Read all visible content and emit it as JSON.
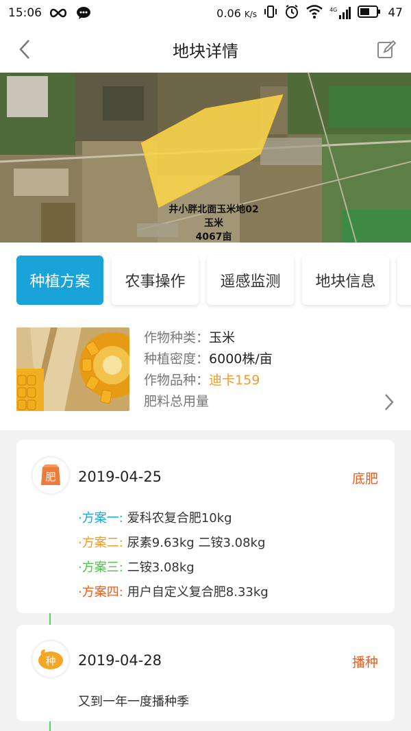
{
  "status_bar": {
    "time": "15:06",
    "speed": "0.06",
    "speed_unit": "K/s",
    "network": "4G",
    "battery": "47"
  },
  "header": {
    "title": "地块详情"
  },
  "map": {
    "plot_name": "井小胖北面玉米地02",
    "crop": "玉米",
    "area": "4067亩"
  },
  "tabs": [
    {
      "label": "种植方案",
      "active": true
    },
    {
      "label": "农事操作",
      "active": false
    },
    {
      "label": "遥感监测",
      "active": false
    },
    {
      "label": "地块信息",
      "active": false
    }
  ],
  "crop_info": {
    "type_label": "作物种类：",
    "type_value": "玉米",
    "density_label": "种植密度：",
    "density_value": "6000株/亩",
    "variety_label": "作物品种：",
    "variety_value": "迪卡159",
    "fertilizer_label": "肥料总用量"
  },
  "events": [
    {
      "badge": "肥",
      "date": "2019-04-25",
      "tag": "底肥",
      "plans": [
        {
          "label": "·方案一:",
          "text": "爱科农复合肥10kg",
          "color": "#1aa3d9"
        },
        {
          "label": "·方案二:",
          "text": "尿素9.63kg 二铵3.08kg",
          "color": "#f39a2b"
        },
        {
          "label": "·方案三:",
          "text": "二铵3.08kg",
          "color": "#4cbf4c"
        },
        {
          "label": "·方案四:",
          "text": "用户自定义复合肥8.33kg",
          "color": "#f05a1a"
        }
      ]
    },
    {
      "badge": "种",
      "date": "2019-04-28",
      "tag": "播种",
      "description": "又到一年一度播种季"
    }
  ],
  "colors": {
    "accent": "#1aa3d9",
    "orange": "#f39a2b",
    "tag": "#f05a1a",
    "timeline": "#4cd964",
    "plot_fill": "#f6d34a"
  }
}
